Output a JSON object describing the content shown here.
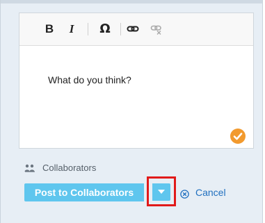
{
  "editor": {
    "toolbar": {
      "bold_label": "B",
      "italic_label": "I",
      "special_char_label": "Ω",
      "link_icon": "link-icon",
      "unlink_icon": "unlink-icon"
    },
    "body_text": "What do you think?",
    "status_icon": "checkmark-icon"
  },
  "collaborators": {
    "icon": "users-icon",
    "label": "Collaborators"
  },
  "actions": {
    "post_label": "Post to Collaborators",
    "dropdown_icon": "caret-down-icon",
    "cancel_icon": "cancel-circle-icon",
    "cancel_label": "Cancel"
  },
  "colors": {
    "panel_bg": "#e7eef5",
    "post_button": "#5fc6ee",
    "highlight": "#e11a1a",
    "check_badge": "#f29a2e",
    "link": "#1f6fbf"
  }
}
